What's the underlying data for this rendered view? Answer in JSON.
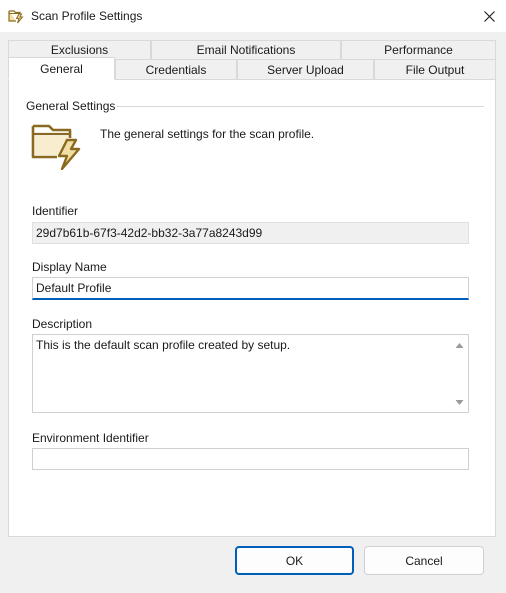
{
  "window": {
    "title": "Scan Profile Settings"
  },
  "tabs": {
    "row1": [
      {
        "label": "Exclusions"
      },
      {
        "label": "Email Notifications"
      },
      {
        "label": "Performance"
      }
    ],
    "row2": [
      {
        "label": "General",
        "active": true
      },
      {
        "label": "Credentials"
      },
      {
        "label": "Server Upload"
      },
      {
        "label": "File Output"
      }
    ]
  },
  "general": {
    "group_title": "General Settings",
    "description": "The general settings for the scan profile.",
    "identifier_label": "Identifier",
    "identifier_value": "29d7b61b-67f3-42d2-bb32-3a77a8243d99",
    "display_name_label": "Display Name",
    "display_name_value": "Default Profile",
    "description_label": "Description",
    "description_value": "This is the default scan profile created by setup.",
    "environment_label": "Environment Identifier",
    "environment_value": ""
  },
  "buttons": {
    "ok": "OK",
    "cancel": "Cancel"
  },
  "colors": {
    "accent": "#005fb8",
    "icon_brown": "#8a6a1f",
    "icon_fill": "#f2dfa6"
  }
}
